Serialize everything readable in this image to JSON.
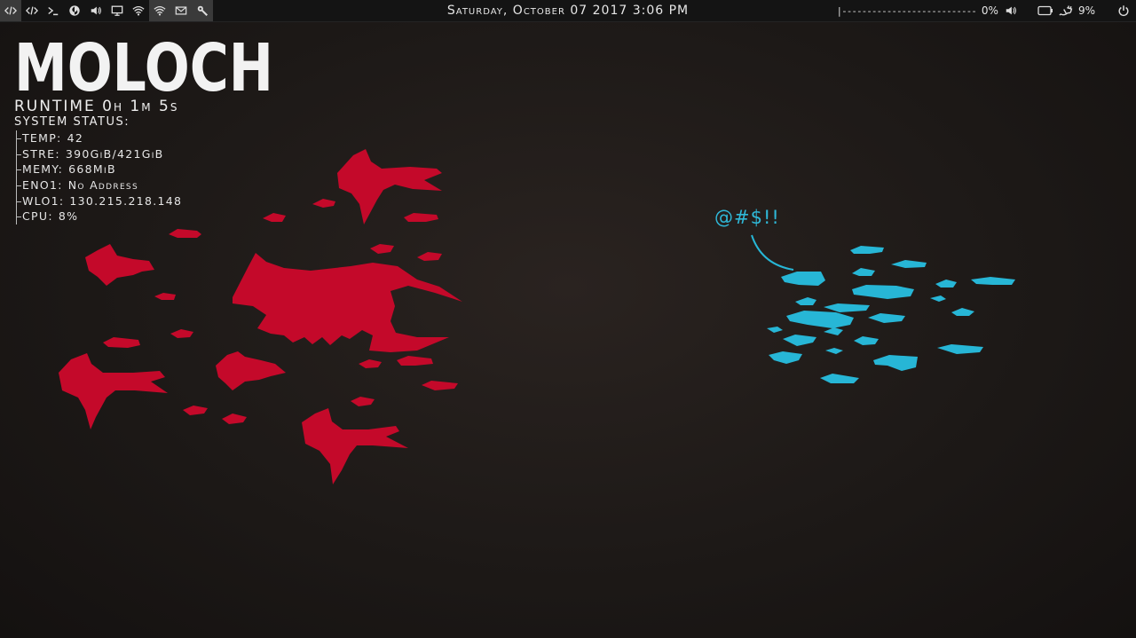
{
  "taskbar": {
    "left_icons": [
      {
        "name": "code-icon",
        "active": true
      },
      {
        "name": "code-icon",
        "active": false
      },
      {
        "name": "terminal-icon",
        "active": false
      },
      {
        "name": "firefox-icon",
        "active": false
      },
      {
        "name": "volume-icon",
        "active": false
      },
      {
        "name": "monitor-icon",
        "active": false
      },
      {
        "name": "wifi-icon",
        "active": false
      },
      {
        "name": "wifi-icon",
        "active": true
      },
      {
        "name": "mail-icon",
        "active": true
      },
      {
        "name": "wrench-icon",
        "active": true
      }
    ],
    "clock": "Saturday, October 07 2017  3:06 PM",
    "volume_bar": "|---------------------------",
    "volume_percent": "0%",
    "battery_percent": "9%"
  },
  "conky": {
    "logo": "MOLOCH",
    "runtime": "RUNTIME 0h 1m 5s",
    "system_status": "SYSTEM STATUS:",
    "stats": [
      {
        "key": "TEMP:",
        "value": "42"
      },
      {
        "key": "STRE:",
        "value": "390GiB/421GiB"
      },
      {
        "key": "MEMY:",
        "value": "668MiB"
      },
      {
        "key": "ENO1:",
        "value": "No Address"
      },
      {
        "key": "WLO1:",
        "value": "130.215.218.148"
      },
      {
        "key": "CPU:",
        "value": "8%"
      }
    ]
  },
  "wallpaper": {
    "speech_text": "@#$!!",
    "colors": {
      "red_fleet": "#c4092a",
      "blue_fleet": "#27b6d6",
      "background": "#1d1917"
    }
  }
}
